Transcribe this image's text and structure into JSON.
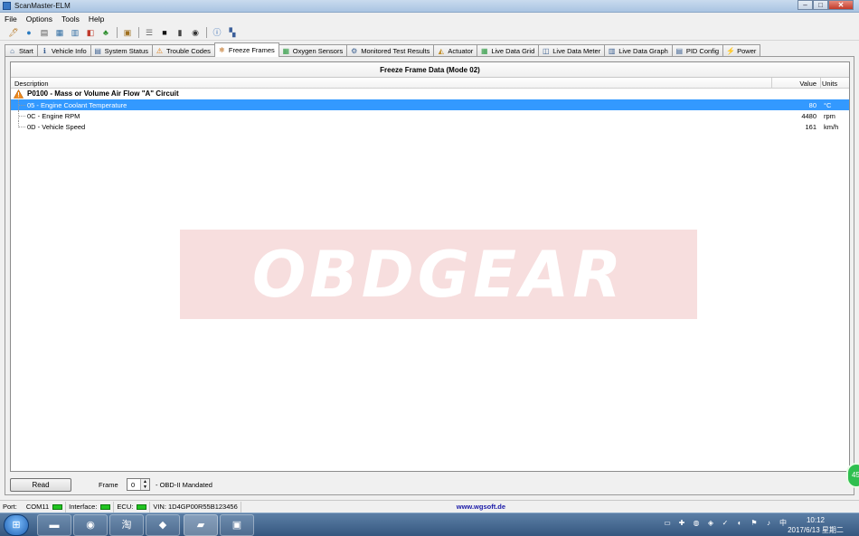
{
  "window": {
    "title": "ScanMaster-ELM"
  },
  "menu": [
    "File",
    "Options",
    "Tools",
    "Help"
  ],
  "tabs": [
    {
      "label": "Start",
      "icon": "home-icon"
    },
    {
      "label": "Vehicle Info",
      "icon": "info-icon"
    },
    {
      "label": "System Status",
      "icon": "status-icon"
    },
    {
      "label": "Trouble Codes",
      "icon": "warning-icon"
    },
    {
      "label": "Freeze Frames",
      "icon": "snowflake-icon",
      "active": true
    },
    {
      "label": "Oxygen Sensors",
      "icon": "sensor-icon"
    },
    {
      "label": "Monitored Test Results",
      "icon": "gear-icon"
    },
    {
      "label": "Actuator",
      "icon": "actuator-icon"
    },
    {
      "label": "Live Data Grid",
      "icon": "grid-icon"
    },
    {
      "label": "Live Data Meter",
      "icon": "meter-icon"
    },
    {
      "label": "Live Data Graph",
      "icon": "graph-icon"
    },
    {
      "label": "PID Config",
      "icon": "pid-icon"
    },
    {
      "label": "Power",
      "icon": "power-icon"
    }
  ],
  "grid": {
    "title": "Freeze Frame Data (Mode 02)",
    "columns": {
      "description": "Description",
      "value": "Value",
      "units": "Units"
    },
    "code": "P0100 - Mass or Volume Air Flow \"A\" Circuit",
    "rows": [
      {
        "label": "05 - Engine Coolant Temperature",
        "value": "80",
        "unit": "°C",
        "selected": true
      },
      {
        "label": "0C - Engine RPM",
        "value": "4480",
        "unit": "rpm",
        "selected": false
      },
      {
        "label": "0D - Vehicle Speed",
        "value": "161",
        "unit": "km/h",
        "selected": false
      }
    ]
  },
  "watermark": "OBDGEAR",
  "controls": {
    "read_label": "Read",
    "frame_label": "Frame",
    "frame_value": "0",
    "frame_note": "- OBD-II Mandated"
  },
  "status": {
    "port_label": "Port:",
    "port_value": "COM11",
    "interface_label": "Interface:",
    "ecu_label": "ECU:",
    "vin": "VIN: 1D4GP00R55B123456",
    "url": "www.wgsoft.de"
  },
  "tray": {
    "time": "10:12",
    "date": "2017/6/13 星期二",
    "badge": "45"
  },
  "colors": {
    "selection": "#3399ff",
    "led": "#21c421",
    "watermark_bg": "#f7dede"
  }
}
